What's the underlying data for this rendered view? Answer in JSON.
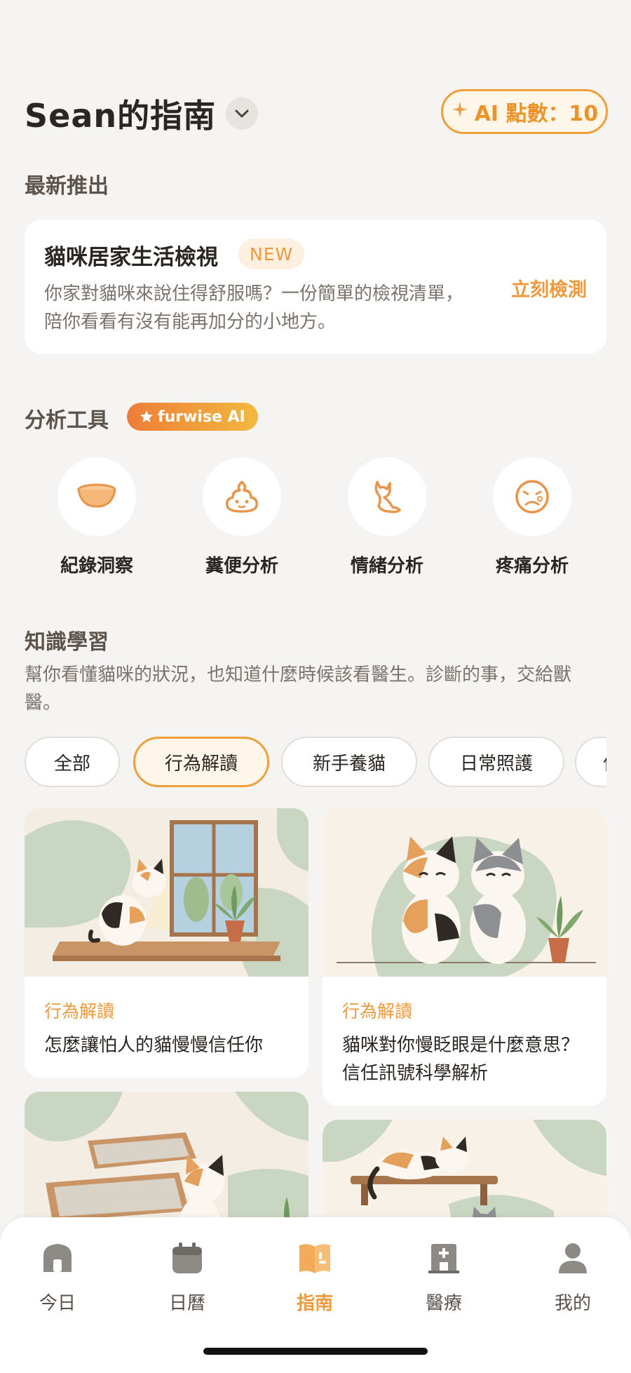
{
  "header": {
    "title": "Sean的指南",
    "ai_points": "AI 點數：10"
  },
  "latest": {
    "section_title": "最新推出",
    "card_title": "貓咪居家生活檢視",
    "badge": "NEW",
    "desc": "你家對貓咪來說住得舒服嗎？一份簡單的檢視清單，陪你看看有沒有能再加分的小地方。",
    "action": "立刻檢測"
  },
  "tools": {
    "section_title": "分析工具",
    "badge": "furwise AI",
    "items": [
      {
        "label": "紀錄洞察",
        "icon": "bowl-icon"
      },
      {
        "label": "糞便分析",
        "icon": "poop-icon"
      },
      {
        "label": "情緒分析",
        "icon": "cat-silhouette-icon"
      },
      {
        "label": "疼痛分析",
        "icon": "pain-face-icon"
      }
    ]
  },
  "knowledge": {
    "section_title": "知識學習",
    "desc": "幫你看懂貓咪的狀況，也知道什麼時候該看醫生。診斷的事，交給獸醫。",
    "filters": [
      "全部",
      "行為解讀",
      "新手養貓",
      "日常照護",
      "信"
    ],
    "active_filter": "行為解讀",
    "articles": [
      {
        "category": "行為解讀",
        "title": "怎麼讓怕人的貓慢慢信任你"
      },
      {
        "category": "行為解讀",
        "title": "貓咪對你慢眨眼是什麼意思？信任訊號科學解析"
      }
    ]
  },
  "nav": {
    "items": [
      {
        "label": "今日",
        "icon": "home-icon"
      },
      {
        "label": "日曆",
        "icon": "calendar-icon"
      },
      {
        "label": "指南",
        "icon": "book-icon"
      },
      {
        "label": "醫療",
        "icon": "hospital-icon"
      },
      {
        "label": "我的",
        "icon": "profile-icon"
      }
    ],
    "active": "指南"
  },
  "colors": {
    "accent": "#ec9a3c",
    "background": "#f6f4f2",
    "card": "#ffffff"
  }
}
